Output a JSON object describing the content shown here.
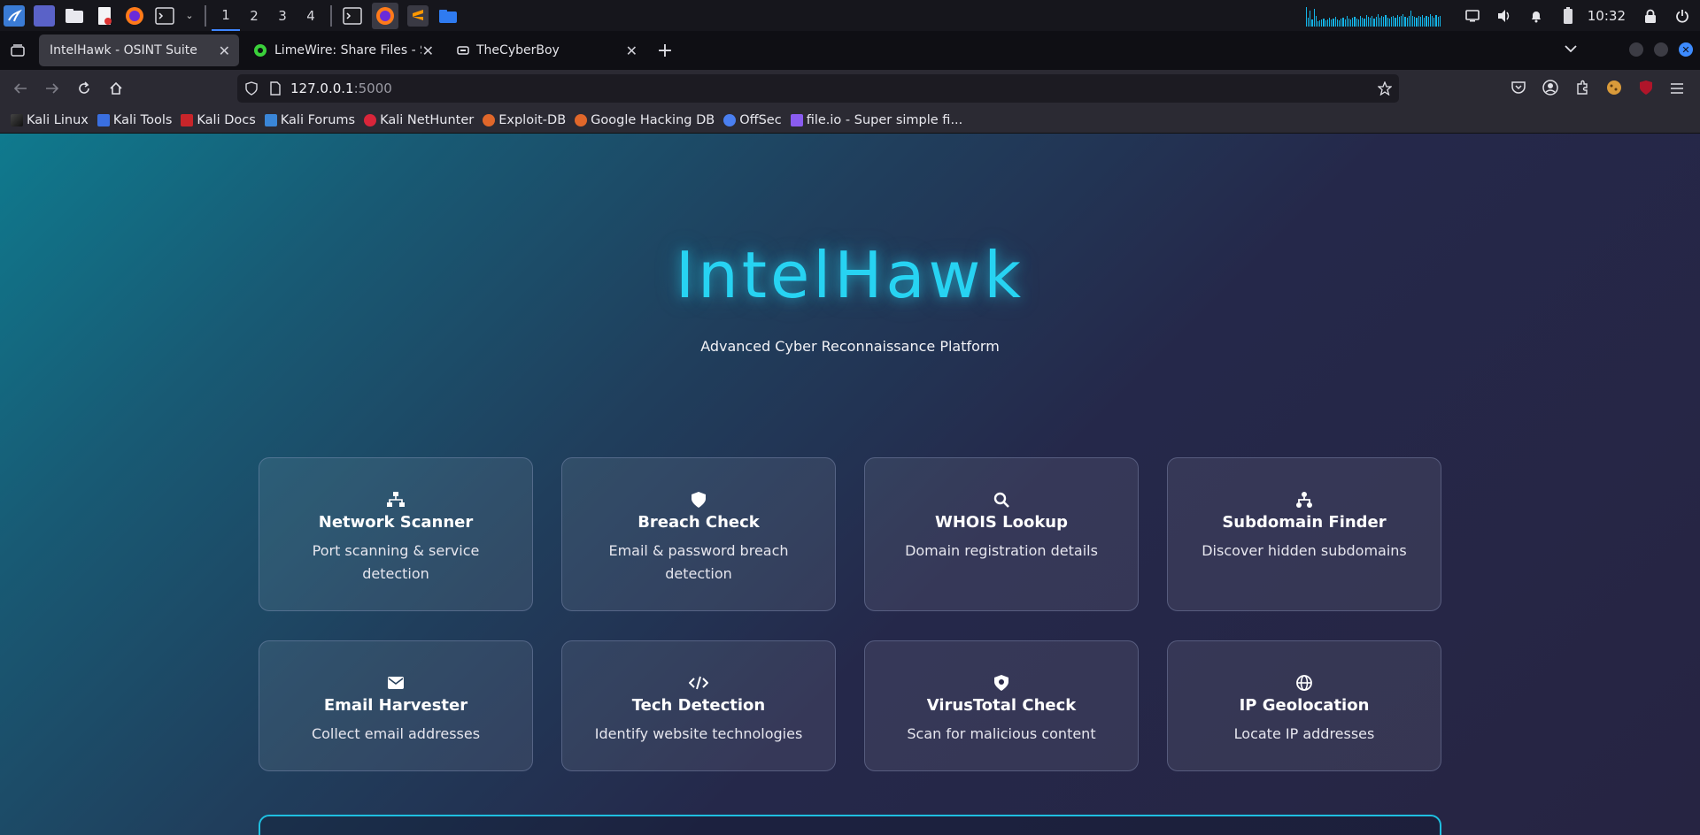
{
  "taskbar": {
    "workspaces": [
      "1",
      "2",
      "3",
      "4"
    ],
    "clock": "10:32"
  },
  "tabs": [
    {
      "title": "IntelHawk - OSINT Suite",
      "active": true
    },
    {
      "title": "LimeWire: Share Files - Se",
      "active": false
    },
    {
      "title": "TheCyberBoy",
      "active": false
    }
  ],
  "url": {
    "host": "127.0.0.1",
    "port": ":5000"
  },
  "bookmarks": [
    {
      "label": "Kali Linux",
      "icon": "kali-dragon-icon"
    },
    {
      "label": "Kali Tools",
      "icon": "kali-tools-icon"
    },
    {
      "label": "Kali Docs",
      "icon": "kali-docs-icon"
    },
    {
      "label": "Kali Forums",
      "icon": "kali-forums-icon"
    },
    {
      "label": "Kali NetHunter",
      "icon": "nethunter-icon"
    },
    {
      "label": "Exploit-DB",
      "icon": "exploit-db-icon"
    },
    {
      "label": "Google Hacking DB",
      "icon": "ghdb-icon"
    },
    {
      "label": "OffSec",
      "icon": "offsec-icon"
    },
    {
      "label": "file.io - Super simple fi...",
      "icon": "fileio-icon"
    }
  ],
  "hero": {
    "title": "IntelHawk",
    "subtitle": "Advanced Cyber Reconnaissance Platform"
  },
  "colors": {
    "accent": "#27d3f2",
    "page_bg_start": "#0f7a8e",
    "page_bg_end": "#262442"
  },
  "tools": [
    {
      "title": "Network Scanner",
      "desc": "Port scanning & service detection",
      "icon": "network-icon"
    },
    {
      "title": "Breach Check",
      "desc": "Email & password breach detection",
      "icon": "shield-icon"
    },
    {
      "title": "WHOIS Lookup",
      "desc": "Domain registration details",
      "icon": "search-icon"
    },
    {
      "title": "Subdomain Finder",
      "desc": "Discover hidden subdomains",
      "icon": "sitemap-icon"
    },
    {
      "title": "Email Harvester",
      "desc": "Collect email addresses",
      "icon": "envelope-icon"
    },
    {
      "title": "Tech Detection",
      "desc": "Identify website technologies",
      "icon": "code-icon"
    },
    {
      "title": "VirusTotal Check",
      "desc": "Scan for malicious content",
      "icon": "shield-virus-icon"
    },
    {
      "title": "IP Geolocation",
      "desc": "Locate IP addresses",
      "icon": "globe-icon"
    }
  ]
}
